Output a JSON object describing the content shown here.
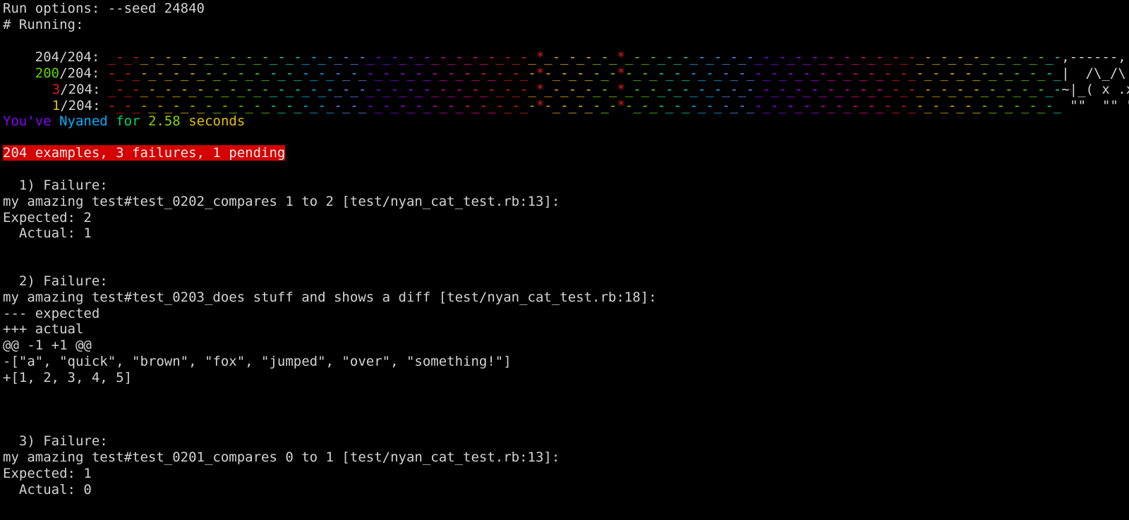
{
  "header": {
    "run_options": "Run options: --seed 24840",
    "running": "# Running:"
  },
  "nyan_rows": [
    {
      "count": "204",
      "total": "/204: ",
      "count_color": "#d3d3d3",
      "cat": ",------,"
    },
    {
      "count": "200",
      "total": "/204: ",
      "count_color": "#5fd700",
      "cat": "|  /\\_/\\"
    },
    {
      "count": "3",
      "total": "/204: ",
      "count_color": "#e01b1b",
      "cat": "~|_( x .x)"
    },
    {
      "count": "1",
      "total": "/204: ",
      "count_color": "#e5c000",
      "cat": "\"\"  \"\" \""
    }
  ],
  "rainbow_colors": [
    "#e01b1b",
    "#e5a000",
    "#e5c000",
    "#87d700",
    "#5fd700",
    "#00d7af",
    "#00afff",
    "#5f87ff",
    "#8700ff",
    "#af00ff",
    "#d700af",
    "#ff0087"
  ],
  "nyan_message": {
    "w1": "You've",
    "w2": "Nyaned",
    "w3": "for",
    "w4": "2.58",
    "w5": "seconds",
    "c1": "#8700ff",
    "c2": "#00afff",
    "c3": "#00d75f",
    "c4": "#87d700",
    "c5": "#e5c000"
  },
  "summary": "204 examples, 3 failures, 1 pending",
  "failures": [
    {
      "heading": "  1) Failure:",
      "lines": [
        "my amazing test#test_0202_compares 1 to 2 [test/nyan_cat_test.rb:13]:",
        "Expected: 2",
        "  Actual: 1"
      ]
    },
    {
      "heading": "  2) Failure:",
      "lines": [
        "my amazing test#test_0203_does stuff and shows a diff [test/nyan_cat_test.rb:18]:",
        "--- expected",
        "+++ actual",
        "@@ -1 +1 @@",
        "-[\"a\", \"quick\", \"brown\", \"fox\", \"jumped\", \"over\", \"something!\"]",
        "+[1, 2, 3, 4, 5]"
      ]
    },
    {
      "heading": "  3) Failure:",
      "lines": [
        "my amazing test#test_0201_compares 0 to 1 [test/nyan_cat_test.rb:13]:",
        "Expected: 1",
        "  Actual: 0"
      ]
    }
  ]
}
